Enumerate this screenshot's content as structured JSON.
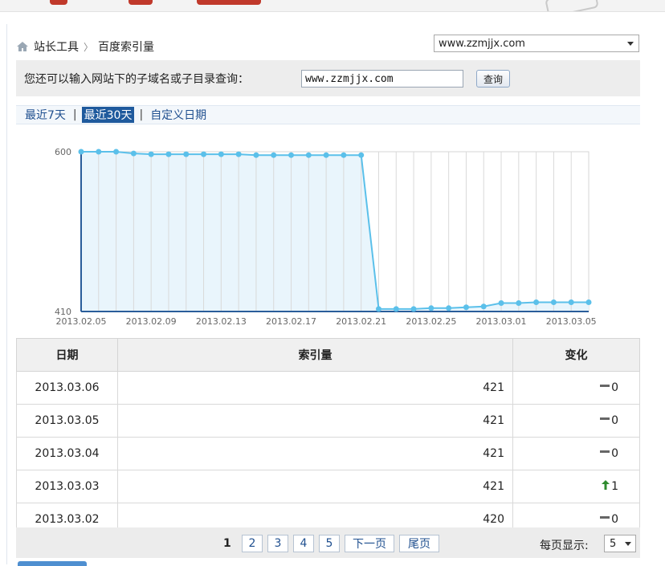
{
  "breadcrumb": {
    "home": "站长工具",
    "current": "百度索引量"
  },
  "site_select": {
    "value": "www.zzmjjx.com"
  },
  "query": {
    "label": "您还可以输入网站下的子域名或子目录查询：",
    "input_value": "www.zzmjjx.com",
    "button": "查询"
  },
  "range_tabs": [
    {
      "label": "最近7天",
      "active": false
    },
    {
      "label": "最近30天",
      "active": true
    },
    {
      "label": "自定义日期",
      "active": false
    }
  ],
  "chart_data": {
    "type": "area",
    "y_ticks": [
      "600",
      "410"
    ],
    "ylim": [
      410,
      600
    ],
    "x_tick_labels": [
      "2013.02.05",
      "2013.02.09",
      "2013.02.13",
      "2013.02.17",
      "2013.02.21",
      "2013.02.25",
      "2013.03.01",
      "2013.03.05"
    ],
    "x": [
      "2013.02.05",
      "2013.02.06",
      "2013.02.07",
      "2013.02.08",
      "2013.02.09",
      "2013.02.10",
      "2013.02.11",
      "2013.02.12",
      "2013.02.13",
      "2013.02.14",
      "2013.02.15",
      "2013.02.16",
      "2013.02.17",
      "2013.02.18",
      "2013.02.19",
      "2013.02.20",
      "2013.02.21",
      "2013.02.22",
      "2013.02.23",
      "2013.02.24",
      "2013.02.25",
      "2013.02.26",
      "2013.02.27",
      "2013.02.28",
      "2013.03.01",
      "2013.03.02",
      "2013.03.03",
      "2013.03.04",
      "2013.03.05",
      "2013.03.06"
    ],
    "values": [
      600,
      600,
      600,
      598,
      597,
      597,
      597,
      597,
      597,
      597,
      596,
      596,
      596,
      596,
      596,
      596,
      596,
      413,
      413,
      413,
      414,
      414,
      415,
      416,
      420,
      420,
      421,
      421,
      421,
      421
    ],
    "line_color": "#5bc0ea",
    "fill_color": "#e9f5fc",
    "grid": true
  },
  "table": {
    "headers": [
      "日期",
      "索引量",
      "变化"
    ],
    "rows": [
      {
        "date": "2013.03.06",
        "value": "421",
        "change": "0",
        "trend": "flat"
      },
      {
        "date": "2013.03.05",
        "value": "421",
        "change": "0",
        "trend": "flat"
      },
      {
        "date": "2013.03.04",
        "value": "421",
        "change": "0",
        "trend": "flat"
      },
      {
        "date": "2013.03.03",
        "value": "421",
        "change": "1",
        "trend": "up"
      },
      {
        "date": "2013.03.02",
        "value": "420",
        "change": "0",
        "trend": "flat"
      }
    ]
  },
  "pager": {
    "current": "1",
    "pages": [
      "2",
      "3",
      "4",
      "5"
    ],
    "next": "下一页",
    "last": "尾页",
    "per_page_label": "每页显示:",
    "per_page_value": "5"
  },
  "colors": {
    "link": "#1f4f8f",
    "active_tab": "#1f5a9d",
    "up_arrow": "#2e8b2e"
  }
}
